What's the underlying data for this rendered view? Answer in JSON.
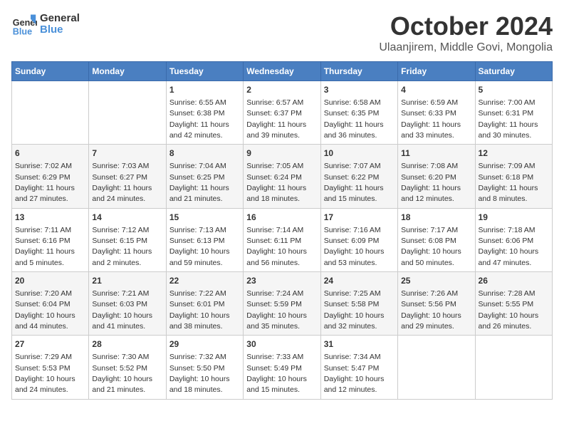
{
  "header": {
    "logo_line1": "General",
    "logo_line2": "Blue",
    "month": "October 2024",
    "location": "Ulaanjirem, Middle Govi, Mongolia"
  },
  "weekdays": [
    "Sunday",
    "Monday",
    "Tuesday",
    "Wednesday",
    "Thursday",
    "Friday",
    "Saturday"
  ],
  "weeks": [
    [
      {
        "day": "",
        "info": ""
      },
      {
        "day": "",
        "info": ""
      },
      {
        "day": "1",
        "info": "Sunrise: 6:55 AM\nSunset: 6:38 PM\nDaylight: 11 hours and 42 minutes."
      },
      {
        "day": "2",
        "info": "Sunrise: 6:57 AM\nSunset: 6:37 PM\nDaylight: 11 hours and 39 minutes."
      },
      {
        "day": "3",
        "info": "Sunrise: 6:58 AM\nSunset: 6:35 PM\nDaylight: 11 hours and 36 minutes."
      },
      {
        "day": "4",
        "info": "Sunrise: 6:59 AM\nSunset: 6:33 PM\nDaylight: 11 hours and 33 minutes."
      },
      {
        "day": "5",
        "info": "Sunrise: 7:00 AM\nSunset: 6:31 PM\nDaylight: 11 hours and 30 minutes."
      }
    ],
    [
      {
        "day": "6",
        "info": "Sunrise: 7:02 AM\nSunset: 6:29 PM\nDaylight: 11 hours and 27 minutes."
      },
      {
        "day": "7",
        "info": "Sunrise: 7:03 AM\nSunset: 6:27 PM\nDaylight: 11 hours and 24 minutes."
      },
      {
        "day": "8",
        "info": "Sunrise: 7:04 AM\nSunset: 6:25 PM\nDaylight: 11 hours and 21 minutes."
      },
      {
        "day": "9",
        "info": "Sunrise: 7:05 AM\nSunset: 6:24 PM\nDaylight: 11 hours and 18 minutes."
      },
      {
        "day": "10",
        "info": "Sunrise: 7:07 AM\nSunset: 6:22 PM\nDaylight: 11 hours and 15 minutes."
      },
      {
        "day": "11",
        "info": "Sunrise: 7:08 AM\nSunset: 6:20 PM\nDaylight: 11 hours and 12 minutes."
      },
      {
        "day": "12",
        "info": "Sunrise: 7:09 AM\nSunset: 6:18 PM\nDaylight: 11 hours and 8 minutes."
      }
    ],
    [
      {
        "day": "13",
        "info": "Sunrise: 7:11 AM\nSunset: 6:16 PM\nDaylight: 11 hours and 5 minutes."
      },
      {
        "day": "14",
        "info": "Sunrise: 7:12 AM\nSunset: 6:15 PM\nDaylight: 11 hours and 2 minutes."
      },
      {
        "day": "15",
        "info": "Sunrise: 7:13 AM\nSunset: 6:13 PM\nDaylight: 10 hours and 59 minutes."
      },
      {
        "day": "16",
        "info": "Sunrise: 7:14 AM\nSunset: 6:11 PM\nDaylight: 10 hours and 56 minutes."
      },
      {
        "day": "17",
        "info": "Sunrise: 7:16 AM\nSunset: 6:09 PM\nDaylight: 10 hours and 53 minutes."
      },
      {
        "day": "18",
        "info": "Sunrise: 7:17 AM\nSunset: 6:08 PM\nDaylight: 10 hours and 50 minutes."
      },
      {
        "day": "19",
        "info": "Sunrise: 7:18 AM\nSunset: 6:06 PM\nDaylight: 10 hours and 47 minutes."
      }
    ],
    [
      {
        "day": "20",
        "info": "Sunrise: 7:20 AM\nSunset: 6:04 PM\nDaylight: 10 hours and 44 minutes."
      },
      {
        "day": "21",
        "info": "Sunrise: 7:21 AM\nSunset: 6:03 PM\nDaylight: 10 hours and 41 minutes."
      },
      {
        "day": "22",
        "info": "Sunrise: 7:22 AM\nSunset: 6:01 PM\nDaylight: 10 hours and 38 minutes."
      },
      {
        "day": "23",
        "info": "Sunrise: 7:24 AM\nSunset: 5:59 PM\nDaylight: 10 hours and 35 minutes."
      },
      {
        "day": "24",
        "info": "Sunrise: 7:25 AM\nSunset: 5:58 PM\nDaylight: 10 hours and 32 minutes."
      },
      {
        "day": "25",
        "info": "Sunrise: 7:26 AM\nSunset: 5:56 PM\nDaylight: 10 hours and 29 minutes."
      },
      {
        "day": "26",
        "info": "Sunrise: 7:28 AM\nSunset: 5:55 PM\nDaylight: 10 hours and 26 minutes."
      }
    ],
    [
      {
        "day": "27",
        "info": "Sunrise: 7:29 AM\nSunset: 5:53 PM\nDaylight: 10 hours and 24 minutes."
      },
      {
        "day": "28",
        "info": "Sunrise: 7:30 AM\nSunset: 5:52 PM\nDaylight: 10 hours and 21 minutes."
      },
      {
        "day": "29",
        "info": "Sunrise: 7:32 AM\nSunset: 5:50 PM\nDaylight: 10 hours and 18 minutes."
      },
      {
        "day": "30",
        "info": "Sunrise: 7:33 AM\nSunset: 5:49 PM\nDaylight: 10 hours and 15 minutes."
      },
      {
        "day": "31",
        "info": "Sunrise: 7:34 AM\nSunset: 5:47 PM\nDaylight: 10 hours and 12 minutes."
      },
      {
        "day": "",
        "info": ""
      },
      {
        "day": "",
        "info": ""
      }
    ]
  ]
}
